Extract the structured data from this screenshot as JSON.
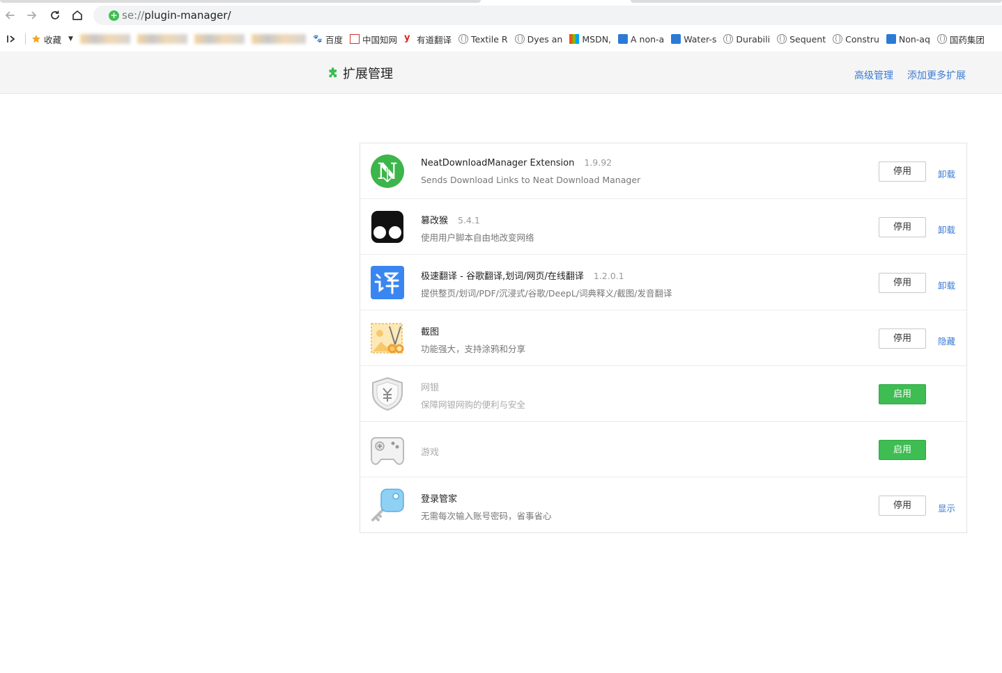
{
  "browser": {
    "address_scheme": "se://",
    "address_path": "plugin-manager/"
  },
  "bookmarks": {
    "favorites_label": "收藏",
    "items": [
      {
        "label": "百度",
        "icon": "baidu-icon"
      },
      {
        "label": "中国知网",
        "icon": "cnki-icon"
      },
      {
        "label": "有道翻译",
        "icon": "youdao-icon"
      },
      {
        "label": "Textile R",
        "icon": "globe-icon"
      },
      {
        "label": "Dyes an",
        "icon": "globe-icon"
      },
      {
        "label": "MSDN,",
        "icon": "msdn-icon"
      },
      {
        "label": "A non-a",
        "icon": "site-icon"
      },
      {
        "label": "Water-s",
        "icon": "site-icon"
      },
      {
        "label": "Durabili",
        "icon": "globe-icon"
      },
      {
        "label": "Sequent",
        "icon": "globe-icon"
      },
      {
        "label": "Constru",
        "icon": "globe-icon"
      },
      {
        "label": "Non-aq",
        "icon": "site-icon"
      },
      {
        "label": "国药集团",
        "icon": "globe-icon"
      }
    ]
  },
  "header": {
    "title": "扩展管理",
    "advanced_link": "高级管理",
    "more_link": "添加更多扩展"
  },
  "extensions": [
    {
      "name": "NeatDownloadManager Extension",
      "version": "1.9.92",
      "desc": "Sends Download Links to Neat Download Manager",
      "button": "停用",
      "link": "卸载",
      "icon": "neat-download-icon"
    },
    {
      "name": "篡改猴",
      "version": "5.4.1",
      "desc": "使用用户脚本自由地改变网络",
      "button": "停用",
      "link": "卸载",
      "icon": "tampermonkey-icon"
    },
    {
      "name": "极速翻译 - 谷歌翻译,划词/网页/在线翻译",
      "version": "1.2.0.1",
      "desc": "提供整页/划词/PDF/沉浸式/谷歌/DeepL/词典释义/截图/发音翻译",
      "button": "停用",
      "link": "卸载",
      "icon": "translate-icon"
    },
    {
      "name": "截图",
      "version": "",
      "desc": "功能强大，支持涂鸦和分享",
      "button": "停用",
      "link": "隐藏",
      "icon": "screenshot-icon"
    },
    {
      "name": "网银",
      "version": "",
      "desc": "保障网银网购的便利与安全",
      "button": "启用",
      "link": "",
      "icon": "bank-shield-icon"
    },
    {
      "name": "游戏",
      "version": "",
      "desc": "",
      "button": "启用",
      "link": "",
      "icon": "gamepad-icon"
    },
    {
      "name": "登录管家",
      "version": "",
      "desc": "无需每次输入账号密码，省事省心",
      "button": "停用",
      "link": "显示",
      "icon": "key-icon"
    }
  ],
  "colors": {
    "accent_link": "#3a7bd5",
    "enable_button": "#3dbd52",
    "header_bg": "#f5f5f5"
  }
}
